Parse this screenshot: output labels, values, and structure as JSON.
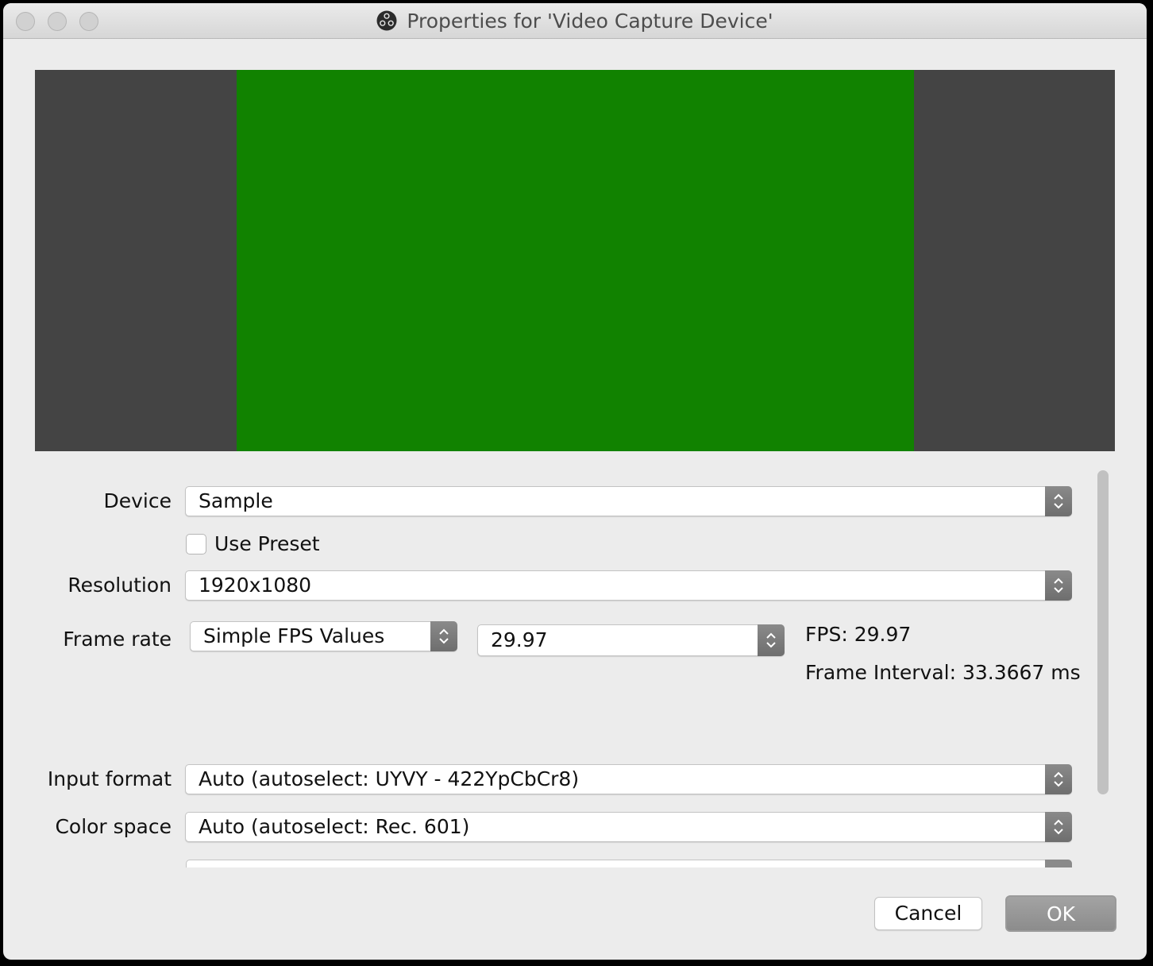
{
  "window": {
    "title": "Properties for 'Video Capture Device'"
  },
  "preview": {
    "frame_color": "#118200",
    "background_color": "#444444"
  },
  "form": {
    "device": {
      "label": "Device",
      "value": "Sample"
    },
    "use_preset": {
      "label": "Use Preset",
      "checked": false
    },
    "resolution": {
      "label": "Resolution",
      "value": "1920x1080"
    },
    "frame_rate": {
      "label": "Frame rate",
      "mode_value": "Simple FPS Values",
      "fps_value": "29.97",
      "fps_info": "FPS: 29.97",
      "interval_info": "Frame Interval: 33.3667 ms"
    },
    "input_format": {
      "label": "Input format",
      "value": "Auto (autoselect: UYVY - 422YpCbCr8)"
    },
    "color_space": {
      "label": "Color space",
      "value": "Auto (autoselect: Rec. 601)"
    }
  },
  "buttons": {
    "cancel": "Cancel",
    "ok": "OK"
  },
  "colors": {
    "window_bg": "#ececec",
    "default_button": "#8c8c8c"
  }
}
